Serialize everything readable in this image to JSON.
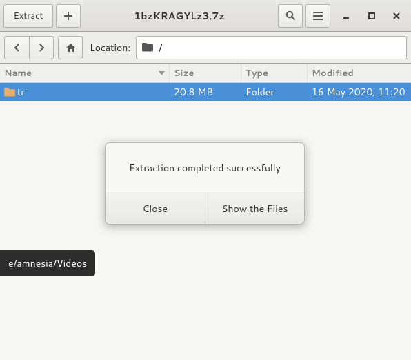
{
  "titlebar": {
    "extract_label": "Extract",
    "title": "1bzKRAGYLz3.7z"
  },
  "toolbar": {
    "location_label": "Location:",
    "path": "/"
  },
  "columns": {
    "name": "Name",
    "size": "Size",
    "type": "Type",
    "modified": "Modified"
  },
  "rows": [
    {
      "name": "tr",
      "size": "20.8 MB",
      "type": "Folder",
      "modified": "16 May 2020, 11:20"
    }
  ],
  "tooltip": "e/amnesia/Videos",
  "dialog": {
    "message": "Extraction completed successfully",
    "close": "Close",
    "show": "Show the Files"
  }
}
